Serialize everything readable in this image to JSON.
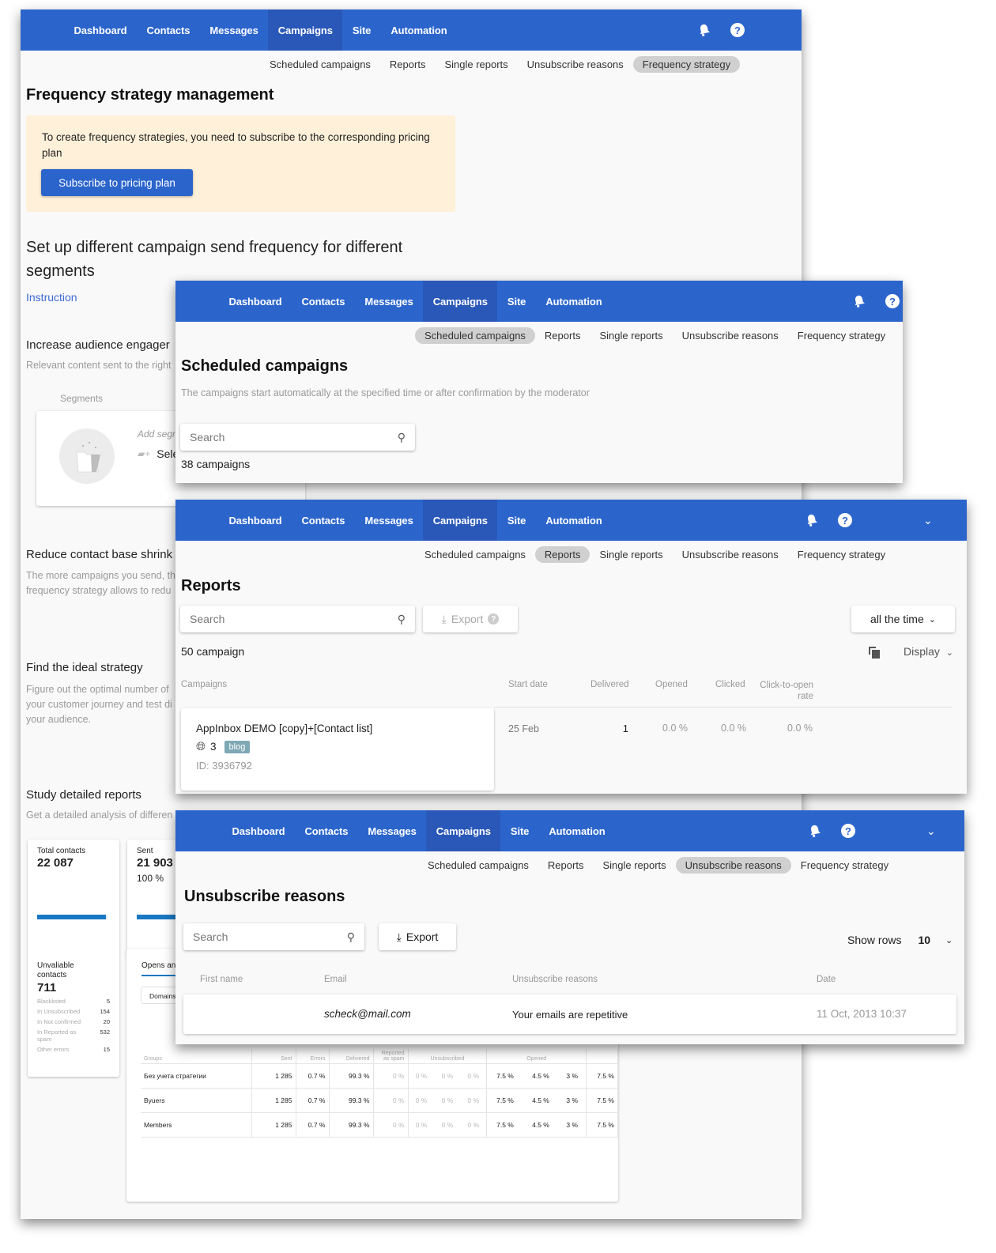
{
  "nav": {
    "items": [
      "Dashboard",
      "Contacts",
      "Messages",
      "Campaigns",
      "Site",
      "Automation"
    ],
    "active": "Campaigns",
    "icons": {
      "notifications": "bell-icon",
      "help": "help-circle-icon",
      "menu": "chevron-down-icon"
    }
  },
  "subnav": {
    "items": [
      "Scheduled campaigns",
      "Reports",
      "Single reports",
      "Unsubscribe reasons",
      "Frequency strategy"
    ]
  },
  "frequency": {
    "title": "Frequency strategy management",
    "notice_text": "To create frequency strategies, you need to subscribe to the corresponding pricing plan",
    "subscribe_button": "Subscribe to pricing plan",
    "headline": "Set up different campaign send frequency for different segments",
    "instruction_link": "Instruction",
    "sections": [
      {
        "title": "Increase audience engager",
        "text": "Relevant content sent to the right"
      },
      {
        "title": "Reduce contact base shrink",
        "text": "The more campaigns you send, th frequency strategy allows to redu"
      },
      {
        "title": "Find the ideal strategy",
        "text": "Figure out the optimal number of your customer journey and test di your audience."
      },
      {
        "title": "Study detailed reports",
        "text": "Get a detailed analysis of differen"
      }
    ],
    "segments_label": "Segments",
    "add_segment_hint": "Add segm",
    "select_label": "Sele",
    "stats": {
      "total_label": "Total contacts",
      "total_value": "22 087",
      "sent_label": "Sent",
      "sent_value": "21 903",
      "sent_percent": "100 %",
      "unavailable_label": "Unvaliable contacts",
      "unavailable_value": "711",
      "breakdown": [
        {
          "label": "Blacklisted",
          "value": "5"
        },
        {
          "label": "In Unsubscribed",
          "value": "154"
        },
        {
          "label": "In Not confirmed",
          "value": "20"
        },
        {
          "label": "In Reported as spam",
          "value": "532"
        },
        {
          "label": "Other errors",
          "value": "15"
        }
      ],
      "tab_label": "Opens an",
      "domains_button": "Domains"
    },
    "groups_table": {
      "headers": [
        "Groups",
        "Sent",
        "Errors",
        "Delivered",
        "Reported as spam",
        "Unsubscribed",
        "Opened"
      ],
      "rows": [
        {
          "group": "Без учета стратегии",
          "sent": "1 285",
          "errors": "0.7 %",
          "delivered": "99.3 %",
          "spam": "0 %",
          "unsub": [
            "0 %",
            "0 %",
            "0 %"
          ],
          "opened": [
            "7.5 %",
            "4.5 %",
            "3 %"
          ],
          "last": "7.5 %"
        },
        {
          "group": "Byuers",
          "sent": "1 285",
          "errors": "0.7 %",
          "delivered": "99.3 %",
          "spam": "0 %",
          "unsub": [
            "0 %",
            "0 %",
            "0 %"
          ],
          "opened": [
            "7.5 %",
            "4.5 %",
            "3 %"
          ],
          "last": "7.5 %"
        },
        {
          "group": "Members",
          "sent": "1 285",
          "errors": "0.7 %",
          "delivered": "99.3 %",
          "spam": "0 %",
          "unsub": [
            "0 %",
            "0 %",
            "0 %"
          ],
          "opened": [
            "7.5 %",
            "4.5 %",
            "3 %"
          ],
          "last": "7.5 %"
        }
      ]
    }
  },
  "scheduled": {
    "title": "Scheduled campaigns",
    "subtitle": "The campaigns start automatically at the specified time or after confirmation by the moderator",
    "search_placeholder": "Search",
    "count_number": "38",
    "count_label": "campaigns"
  },
  "reports": {
    "title": "Reports",
    "search_placeholder": "Search",
    "export_label": "Export",
    "period": "all the time",
    "count_number": "50",
    "count_label": "campaign",
    "display_label": "Display",
    "headers": {
      "campaigns": "Campaigns",
      "start_date": "Start date",
      "delivered": "Delivered",
      "opened": "Opened",
      "clicked": "Clicked",
      "ctor": "Click-to-open rate"
    },
    "row": {
      "name": "AppInbox DEMO [copy]+[Contact list]",
      "sites": "3",
      "tag": "blog",
      "id": "ID: 3936792",
      "start_date": "25 Feb",
      "delivered": "1",
      "opened": "0.0 %",
      "clicked": "0.0 %",
      "ctor": "0.0 %"
    }
  },
  "unsubscribe": {
    "title": "Unsubscribe reasons",
    "search_placeholder": "Search",
    "export_label": "Export",
    "show_rows_label": "Show rows",
    "show_rows_value": "10",
    "headers": {
      "first_name": "First name",
      "email": "Email",
      "reason": "Unsubscribe reasons",
      "date": "Date"
    },
    "row": {
      "first_name": "",
      "email": "scheck@mail.com",
      "reason": "Your emails are repetitive",
      "date": "11 Oct, 2013 10:37"
    }
  },
  "colors": {
    "brand": "#2b65cc",
    "notice_bg": "#fff0d9",
    "link": "#3f6ad8",
    "tag_bg": "#7fa8b5",
    "progress": "#1a78c2"
  }
}
